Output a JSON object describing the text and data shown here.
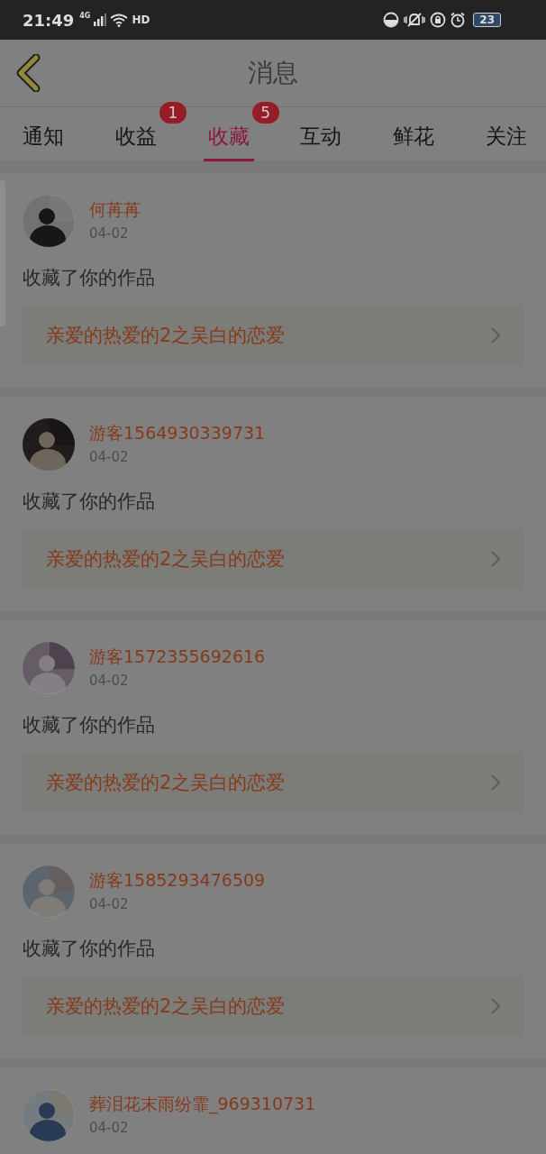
{
  "status_bar": {
    "time": "21:49",
    "network": "4G",
    "call": "HD",
    "battery": "23"
  },
  "header": {
    "title": "消息"
  },
  "tabs": [
    {
      "label": "通知",
      "selected": false
    },
    {
      "label": "收益",
      "selected": false,
      "badge": "1"
    },
    {
      "label": "收藏",
      "selected": true,
      "badge": "5"
    },
    {
      "label": "互动",
      "selected": false
    },
    {
      "label": "鲜花",
      "selected": false
    },
    {
      "label": "关注",
      "selected": false
    }
  ],
  "messages": [
    {
      "user": "何苒苒",
      "date": "04-02",
      "action": "收藏了你的作品",
      "work": "亲爱的热爱的2之吴白的恋爱"
    },
    {
      "user": "游客1564930339731",
      "date": "04-02",
      "action": "收藏了你的作品",
      "work": "亲爱的热爱的2之吴白的恋爱"
    },
    {
      "user": "游客1572355692616",
      "date": "04-02",
      "action": "收藏了你的作品",
      "work": "亲爱的热爱的2之吴白的恋爱"
    },
    {
      "user": "游客1585293476509",
      "date": "04-02",
      "action": "收藏了你的作品",
      "work": "亲爱的热爱的2之吴白的恋爱"
    },
    {
      "user": "葬泪花末雨纷霏_969310731",
      "date": "04-02"
    }
  ]
}
